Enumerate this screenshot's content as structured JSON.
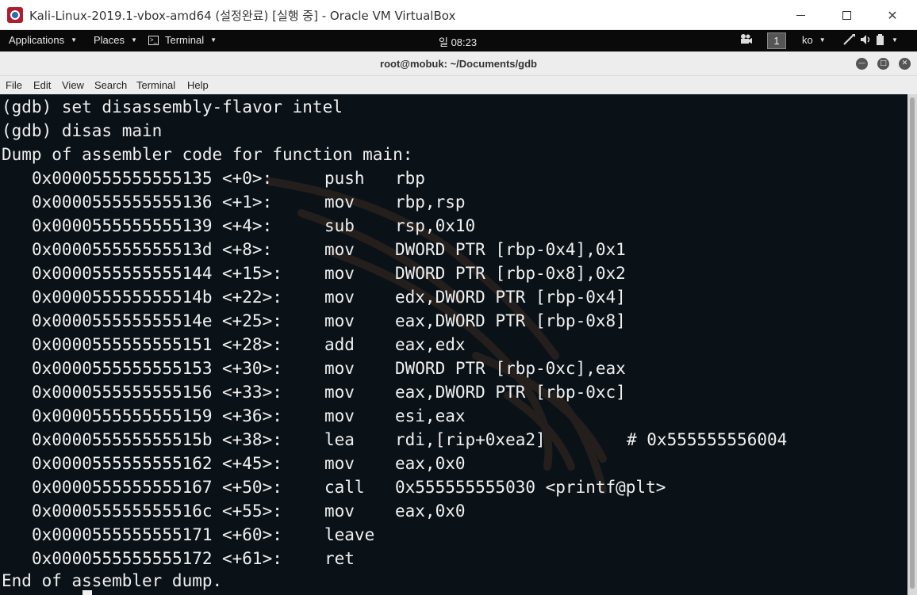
{
  "vbox": {
    "title": "Kali-Linux-2019.1-vbox-amd64 (설정완료) [실행 중] - Oracle VM VirtualBox",
    "minimize": "—",
    "maximize": "☐",
    "close": "✕"
  },
  "topbar": {
    "applications": "Applications",
    "places": "Places",
    "terminal": "Terminal",
    "clock": "일 08:23",
    "workspace": "1",
    "lang": "ko"
  },
  "terminal": {
    "title": "root@mobuk: ~/Documents/gdb",
    "menu": [
      "File",
      "Edit",
      "View",
      "Search",
      "Terminal",
      "Help"
    ]
  },
  "output": {
    "lines": [
      "(gdb) set disassembly-flavor intel",
      "(gdb) disas main",
      "Dump of assembler code for function main:"
    ],
    "asm": [
      {
        "addr": "0x0000555555555135",
        "off": "<+0>:",
        "mn": "push",
        "op": "rbp",
        "cm": ""
      },
      {
        "addr": "0x0000555555555136",
        "off": "<+1>:",
        "mn": "mov",
        "op": "rbp,rsp",
        "cm": ""
      },
      {
        "addr": "0x0000555555555139",
        "off": "<+4>:",
        "mn": "sub",
        "op": "rsp,0x10",
        "cm": ""
      },
      {
        "addr": "0x000055555555513d",
        "off": "<+8>:",
        "mn": "mov",
        "op": "DWORD PTR [rbp-0x4],0x1",
        "cm": ""
      },
      {
        "addr": "0x0000555555555144",
        "off": "<+15>:",
        "mn": "mov",
        "op": "DWORD PTR [rbp-0x8],0x2",
        "cm": ""
      },
      {
        "addr": "0x000055555555514b",
        "off": "<+22>:",
        "mn": "mov",
        "op": "edx,DWORD PTR [rbp-0x4]",
        "cm": ""
      },
      {
        "addr": "0x000055555555514e",
        "off": "<+25>:",
        "mn": "mov",
        "op": "eax,DWORD PTR [rbp-0x8]",
        "cm": ""
      },
      {
        "addr": "0x0000555555555151",
        "off": "<+28>:",
        "mn": "add",
        "op": "eax,edx",
        "cm": ""
      },
      {
        "addr": "0x0000555555555153",
        "off": "<+30>:",
        "mn": "mov",
        "op": "DWORD PTR [rbp-0xc],eax",
        "cm": ""
      },
      {
        "addr": "0x0000555555555156",
        "off": "<+33>:",
        "mn": "mov",
        "op": "eax,DWORD PTR [rbp-0xc]",
        "cm": ""
      },
      {
        "addr": "0x0000555555555159",
        "off": "<+36>:",
        "mn": "mov",
        "op": "esi,eax",
        "cm": ""
      },
      {
        "addr": "0x000055555555515b",
        "off": "<+38>:",
        "mn": "lea",
        "op": "rdi,[rip+0xea2]",
        "cm": "# 0x555555556004"
      },
      {
        "addr": "0x0000555555555162",
        "off": "<+45>:",
        "mn": "mov",
        "op": "eax,0x0",
        "cm": ""
      },
      {
        "addr": "0x0000555555555167",
        "off": "<+50>:",
        "mn": "call",
        "op": "0x555555555030 <printf@plt>",
        "cm": ""
      },
      {
        "addr": "0x000055555555516c",
        "off": "<+55>:",
        "mn": "mov",
        "op": "eax,0x0",
        "cm": ""
      },
      {
        "addr": "0x0000555555555171",
        "off": "<+60>:",
        "mn": "leave",
        "op": "",
        "cm": ""
      },
      {
        "addr": "0x0000555555555172",
        "off": "<+61>:",
        "mn": "ret",
        "op": "",
        "cm": ""
      }
    ],
    "end": "End of assembler dump."
  }
}
